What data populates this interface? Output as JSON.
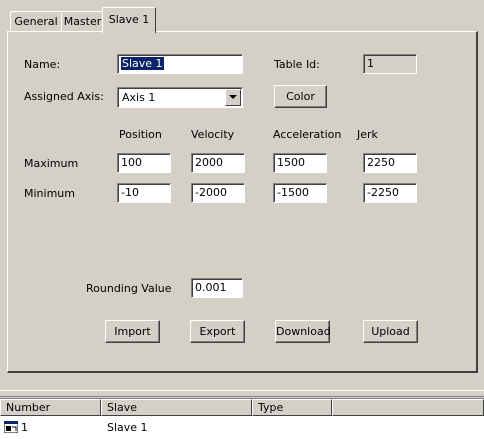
{
  "tabs": [
    {
      "label": "General"
    },
    {
      "label": "Master"
    },
    {
      "label": "Slave 1"
    }
  ],
  "form": {
    "name_label": "Name:",
    "name_value": "Slave 1",
    "table_id_label": "Table Id:",
    "table_id_value": "1",
    "assigned_axis_label": "Assigned Axis:",
    "assigned_axis_value": "Axis 1",
    "color_button": "Color",
    "columns": [
      "Position",
      "Velocity",
      "Acceleration",
      "Jerk"
    ],
    "maximum_label": "Maximum",
    "minimum_label": "Minimum",
    "maximum": [
      "100",
      "2000",
      "1500",
      "2250"
    ],
    "minimum": [
      "-10",
      "-2000",
      "-1500",
      "-2250"
    ],
    "rounding_label": "Rounding Value",
    "rounding_value": "0.001",
    "buttons": {
      "import": "Import",
      "export": "Export",
      "download": "Download",
      "upload": "Upload"
    }
  },
  "list": {
    "headers": [
      "Number",
      "Slave",
      "Type"
    ],
    "rows": [
      {
        "number": "1",
        "slave": "Slave 1",
        "type": ""
      }
    ]
  }
}
